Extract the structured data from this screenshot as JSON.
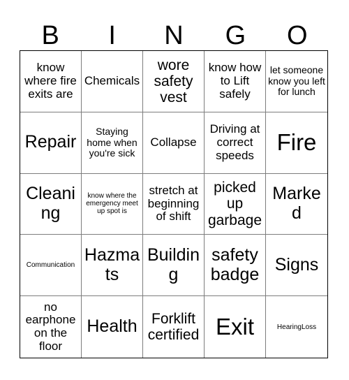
{
  "card": {
    "title": "BINGO Card",
    "header_letters": [
      "B",
      "I",
      "N",
      "G",
      "O"
    ],
    "colors": {
      "background": "#ffffff",
      "cell_background": "#ffffff",
      "text": "#000000",
      "inner_border": "#7d7d7d",
      "outer_border": "#000000"
    },
    "rows": [
      [
        {
          "text": "know where fire exits are",
          "size": "fs-md"
        },
        {
          "text": "Chemicals",
          "size": "fs-md"
        },
        {
          "text": "wore safety vest",
          "size": "fs-lg"
        },
        {
          "text": "know how to Lift safely",
          "size": "fs-md"
        },
        {
          "text": "let someone know you left for lunch",
          "size": "fs-sm"
        }
      ],
      [
        {
          "text": "Repair",
          "size": "fs-xl"
        },
        {
          "text": "Staying home when you're sick",
          "size": "fs-sm"
        },
        {
          "text": "Collapse",
          "size": "fs-md"
        },
        {
          "text": "Driving at correct speeds",
          "size": "fs-md"
        },
        {
          "text": "Fire",
          "size": "fs-xxl"
        }
      ],
      [
        {
          "text": "Cleaning",
          "size": "fs-xl"
        },
        {
          "text": "know where the emergency meet up spot is",
          "size": "fs-xs"
        },
        {
          "text": "stretch at beginning of shift",
          "size": "fs-md"
        },
        {
          "text": "picked up garbage",
          "size": "fs-lg"
        },
        {
          "text": "Marked",
          "size": "fs-xl"
        }
      ],
      [
        {
          "text": "Communication",
          "size": "fs-xs"
        },
        {
          "text": "Hazmats",
          "size": "fs-xl"
        },
        {
          "text": "Building",
          "size": "fs-xl"
        },
        {
          "text": "safety badge",
          "size": "fs-xl"
        },
        {
          "text": "Signs",
          "size": "fs-xl"
        }
      ],
      [
        {
          "text": "no earphone on the floor",
          "size": "fs-md"
        },
        {
          "text": "Health",
          "size": "fs-xl"
        },
        {
          "text": "Forklift certified",
          "size": "fs-lg"
        },
        {
          "text": "Exit",
          "size": "fs-xxl"
        },
        {
          "text": "HearingLoss",
          "size": "fs-xs"
        }
      ]
    ]
  }
}
